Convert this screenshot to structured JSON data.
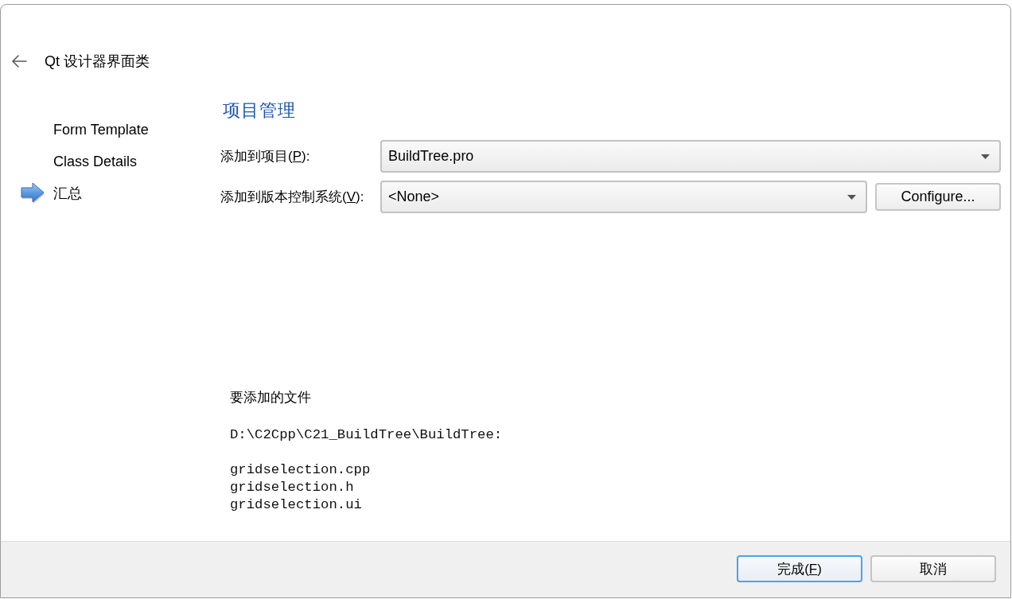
{
  "dialog": {
    "title": "Qt 设计器界面类"
  },
  "sidebar": {
    "items": [
      {
        "label": "Form Template",
        "selected": false
      },
      {
        "label": "Class Details",
        "selected": false
      },
      {
        "label": "汇总",
        "selected": true
      }
    ]
  },
  "section": {
    "heading": "项目管理"
  },
  "fields": [
    {
      "kind": "dropdown",
      "label": {
        "before": "添加到项目(",
        "mnemonic": "P",
        "after": "):"
      },
      "value": "BuildTree.pro"
    },
    {
      "kind": "dropdown",
      "label": {
        "before": "添加到版本控制系统(",
        "mnemonic": "V",
        "after": "):"
      },
      "value": "<None>",
      "button": "Configure..."
    }
  ],
  "files": {
    "heading": "要添加的文件",
    "directory": "D:\\C2Cpp\\C21_BuildTree\\BuildTree:",
    "items": [
      "gridselection.cpp",
      "gridselection.h",
      "gridselection.ui"
    ]
  },
  "buttons": [
    {
      "label": {
        "before": "完成(",
        "mnemonic": "F",
        "after": ")"
      },
      "default": true
    },
    {
      "label": {
        "before": "取消"
      },
      "default": false
    }
  ]
}
